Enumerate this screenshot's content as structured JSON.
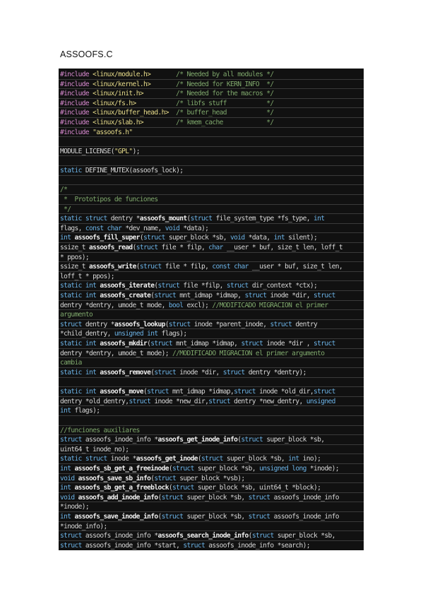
{
  "title": "ASSOOFS.C",
  "code_lines": [
    [
      [
        "pp",
        "#include "
      ],
      [
        "str",
        "<linux/module.h>"
      ],
      [
        "t",
        "       "
      ],
      [
        "cm",
        "/* Needed by all modules */"
      ]
    ],
    [
      [
        "pp",
        "#include "
      ],
      [
        "str",
        "<linux/kernel.h>"
      ],
      [
        "t",
        "       "
      ],
      [
        "cm",
        "/* Needed for KERN_INFO  */"
      ]
    ],
    [
      [
        "pp",
        "#include "
      ],
      [
        "str",
        "<linux/init.h>"
      ],
      [
        "t",
        "         "
      ],
      [
        "cm",
        "/* Needed for the macros */"
      ]
    ],
    [
      [
        "pp",
        "#include "
      ],
      [
        "str",
        "<linux/fs.h>"
      ],
      [
        "t",
        "           "
      ],
      [
        "cm",
        "/* libfs stuff           */"
      ]
    ],
    [
      [
        "pp",
        "#include "
      ],
      [
        "str",
        "<linux/buffer_head.h>"
      ],
      [
        "t",
        "  "
      ],
      [
        "cm",
        "/* buffer_head           */"
      ]
    ],
    [
      [
        "pp",
        "#include "
      ],
      [
        "str",
        "<linux/slab.h>"
      ],
      [
        "t",
        "         "
      ],
      [
        "cm",
        "/* kmem_cache            */"
      ]
    ],
    [
      [
        "pp",
        "#include "
      ],
      [
        "str",
        "\"assoofs.h\""
      ]
    ],
    [],
    [
      [
        "t",
        "MODULE_LICENSE("
      ],
      [
        "str",
        "\"GPL\""
      ],
      [
        "t",
        ");"
      ]
    ],
    [],
    [
      [
        "k",
        "static "
      ],
      [
        "t",
        "DEFINE_MUTEX(assoofs_lock);"
      ]
    ],
    [],
    [
      [
        "cm",
        "/*"
      ]
    ],
    [
      [
        "cm",
        " *  Prototipos de funciones"
      ]
    ],
    [
      [
        "cm",
        " */"
      ]
    ],
    [
      [
        "k",
        "static struct "
      ],
      [
        "t",
        "dentry *"
      ],
      [
        "fn",
        "assoofs_mount"
      ],
      [
        "t",
        "("
      ],
      [
        "k",
        "struct "
      ],
      [
        "t",
        "file_system_type *fs_type, "
      ],
      [
        "k",
        "int"
      ]
    ],
    [
      [
        "t",
        "flags, "
      ],
      [
        "k",
        "const char "
      ],
      [
        "t",
        "*dev_name, "
      ],
      [
        "k",
        "void "
      ],
      [
        "t",
        "*data);"
      ]
    ],
    [
      [
        "k",
        "int "
      ],
      [
        "fn",
        "assoofs_fill_super"
      ],
      [
        "t",
        "("
      ],
      [
        "k",
        "struct "
      ],
      [
        "t",
        "super_block *sb, "
      ],
      [
        "k",
        "void "
      ],
      [
        "t",
        "*data, "
      ],
      [
        "k",
        "int "
      ],
      [
        "t",
        "silent);"
      ]
    ],
    [
      [
        "t",
        "ssize_t "
      ],
      [
        "fn",
        "assoofs_read"
      ],
      [
        "t",
        "("
      ],
      [
        "k",
        "struct "
      ],
      [
        "t",
        "file * filp, "
      ],
      [
        "k",
        "char "
      ],
      [
        "t",
        "__user * buf, size_t len, loff_t"
      ]
    ],
    [
      [
        "t",
        "* ppos);"
      ]
    ],
    [
      [
        "t",
        "ssize_t "
      ],
      [
        "fn",
        "assoofs_write"
      ],
      [
        "t",
        "("
      ],
      [
        "k",
        "struct "
      ],
      [
        "t",
        "file * filp, "
      ],
      [
        "k",
        "const char "
      ],
      [
        "t",
        "__user * buf, size_t len,"
      ]
    ],
    [
      [
        "t",
        "loff_t * ppos);"
      ]
    ],
    [
      [
        "k",
        "static int "
      ],
      [
        "fn",
        "assoofs_iterate"
      ],
      [
        "t",
        "("
      ],
      [
        "k",
        "struct "
      ],
      [
        "t",
        "file *filp, "
      ],
      [
        "k",
        "struct "
      ],
      [
        "t",
        "dir_context *ctx);"
      ]
    ],
    [
      [
        "k",
        "static int "
      ],
      [
        "fn",
        "assoofs_create"
      ],
      [
        "t",
        "("
      ],
      [
        "k",
        "struct "
      ],
      [
        "t",
        "mnt_idmap *idmap, "
      ],
      [
        "k",
        "struct "
      ],
      [
        "t",
        "inode *dir, "
      ],
      [
        "k",
        "struct"
      ]
    ],
    [
      [
        "t",
        "dentry *dentry, umode_t mode, "
      ],
      [
        "k",
        "bool "
      ],
      [
        "t",
        "excl); "
      ],
      [
        "cm",
        "//MODIFICADO MIGRACION el primer"
      ]
    ],
    [
      [
        "cm",
        "argumento"
      ]
    ],
    [
      [
        "k",
        "struct "
      ],
      [
        "t",
        "dentry *"
      ],
      [
        "fn",
        "assoofs_lookup"
      ],
      [
        "t",
        "("
      ],
      [
        "k",
        "struct "
      ],
      [
        "t",
        "inode *parent_inode, "
      ],
      [
        "k",
        "struct "
      ],
      [
        "t",
        "dentry"
      ]
    ],
    [
      [
        "t",
        "*child_dentry, "
      ],
      [
        "k",
        "unsigned int "
      ],
      [
        "t",
        "flags);"
      ]
    ],
    [
      [
        "k",
        "static int "
      ],
      [
        "fn",
        "assoofs_mkdir"
      ],
      [
        "t",
        "("
      ],
      [
        "k",
        "struct "
      ],
      [
        "t",
        "mnt_idmap *idmap, "
      ],
      [
        "k",
        "struct "
      ],
      [
        "t",
        "inode *dir , "
      ],
      [
        "k",
        "struct"
      ]
    ],
    [
      [
        "t",
        "dentry *dentry, umode_t mode); "
      ],
      [
        "cm",
        "//MODIFICADO MIGRACION el primer argumento"
      ]
    ],
    [
      [
        "cm",
        "cambia"
      ]
    ],
    [
      [
        "k",
        "static int "
      ],
      [
        "fn",
        "assoofs_remove"
      ],
      [
        "t",
        "("
      ],
      [
        "k",
        "struct "
      ],
      [
        "t",
        "inode *dir, "
      ],
      [
        "k",
        "struct "
      ],
      [
        "t",
        "dentry *dentry);"
      ]
    ],
    [],
    [
      [
        "k",
        "static int "
      ],
      [
        "fn",
        "assoofs_move"
      ],
      [
        "t",
        "("
      ],
      [
        "k",
        "struct "
      ],
      [
        "t",
        "mnt_idmap *idmap,"
      ],
      [
        "k",
        "struct "
      ],
      [
        "t",
        "inode *old_dir,"
      ],
      [
        "k",
        "struct"
      ]
    ],
    [
      [
        "t",
        "dentry *old_dentry,"
      ],
      [
        "k",
        "struct "
      ],
      [
        "t",
        "inode *new_dir,"
      ],
      [
        "k",
        "struct "
      ],
      [
        "t",
        "dentry *new_dentry, "
      ],
      [
        "k",
        "unsigned"
      ]
    ],
    [
      [
        "k",
        "int "
      ],
      [
        "t",
        "flags);"
      ]
    ],
    [],
    [
      [
        "cm",
        "//funciones auxiliares"
      ]
    ],
    [
      [
        "k",
        "struct "
      ],
      [
        "t",
        "assoofs_inode_info *"
      ],
      [
        "fn",
        "assoofs_get_inode_info"
      ],
      [
        "t",
        "("
      ],
      [
        "k",
        "struct "
      ],
      [
        "t",
        "super_block *sb,"
      ]
    ],
    [
      [
        "t",
        "uint64_t inode_no);"
      ]
    ],
    [
      [
        "k",
        "static struct "
      ],
      [
        "t",
        "inode *"
      ],
      [
        "fn",
        "assoofs_get_inode"
      ],
      [
        "t",
        "("
      ],
      [
        "k",
        "struct "
      ],
      [
        "t",
        "super_block *sb, "
      ],
      [
        "k",
        "int "
      ],
      [
        "t",
        "ino);"
      ]
    ],
    [
      [
        "k",
        "int "
      ],
      [
        "fn",
        "assoofs_sb_get_a_freeinode"
      ],
      [
        "t",
        "("
      ],
      [
        "k",
        "struct "
      ],
      [
        "t",
        "super_block *sb, "
      ],
      [
        "k",
        "unsigned long "
      ],
      [
        "t",
        "*inode);"
      ]
    ],
    [
      [
        "k",
        "void "
      ],
      [
        "fn",
        "assoofs_save_sb_info"
      ],
      [
        "t",
        "("
      ],
      [
        "k",
        "struct "
      ],
      [
        "t",
        "super_block *vsb);"
      ]
    ],
    [
      [
        "k",
        "int "
      ],
      [
        "fn",
        "assoofs_sb_get_a_freeblock"
      ],
      [
        "t",
        "("
      ],
      [
        "k",
        "struct "
      ],
      [
        "t",
        "super_block *sb, uint64_t *block);"
      ]
    ],
    [
      [
        "k",
        "void "
      ],
      [
        "fn",
        "assoofs_add_inode_info"
      ],
      [
        "t",
        "("
      ],
      [
        "k",
        "struct "
      ],
      [
        "t",
        "super_block *sb, "
      ],
      [
        "k",
        "struct "
      ],
      [
        "t",
        "assoofs_inode_info"
      ]
    ],
    [
      [
        "t",
        "*inode);"
      ]
    ],
    [
      [
        "k",
        "int "
      ],
      [
        "fn",
        "assoofs_save_inode_info"
      ],
      [
        "t",
        "("
      ],
      [
        "k",
        "struct "
      ],
      [
        "t",
        "super_block *sb, "
      ],
      [
        "k",
        "struct "
      ],
      [
        "t",
        "assoofs_inode_info"
      ]
    ],
    [
      [
        "t",
        "*inode_info);"
      ]
    ],
    [
      [
        "k",
        "struct "
      ],
      [
        "t",
        "assoofs_inode_info *"
      ],
      [
        "fn",
        "assoofs_search_inode_info"
      ],
      [
        "t",
        "("
      ],
      [
        "k",
        "struct "
      ],
      [
        "t",
        "super_block *sb,"
      ]
    ],
    [
      [
        "k",
        "struct "
      ],
      [
        "t",
        "assoofs_inode_info *start, "
      ],
      [
        "k",
        "struct "
      ],
      [
        "t",
        "assoofs_inode_info *search);"
      ]
    ]
  ],
  "colors": {
    "background": "#111111",
    "keyword": "#6cb4e8",
    "preprocessor": "#d98ad0",
    "string": "#e7dc8a",
    "comment": "#7fa86c",
    "function": "#f0f0f0",
    "text": "#d8d8d8"
  }
}
